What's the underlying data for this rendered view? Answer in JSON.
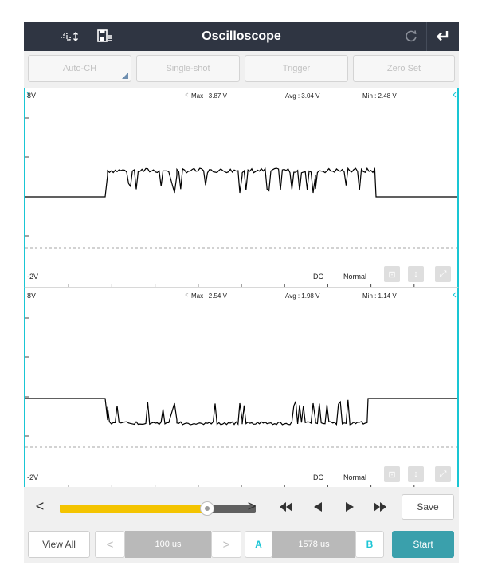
{
  "header": {
    "title": "Oscilloscope",
    "left_icons": [
      "waveform-icon",
      "save-list-icon"
    ],
    "right_icons": [
      "refresh-icon",
      "back-arrow-icon"
    ]
  },
  "toolbar": {
    "auto_ch": "Auto-CH",
    "single_shot": "Single-shot",
    "trigger": "Trigger",
    "zero_set": "Zero Set"
  },
  "channel1": {
    "top_label": "8V",
    "bottom_label": "-2V",
    "max": "Max : 3.87 V",
    "avg": "Avg : 3.04 V",
    "min": "Min : 2.48 V",
    "coupling": "DC",
    "mode": "Normal"
  },
  "channel2": {
    "top_label": "8V",
    "bottom_label": "-2V",
    "max": "Max : 2.54 V",
    "avg": "Avg : 1.98 V",
    "min": "Min : 1.14 V",
    "coupling": "DC",
    "mode": "Normal"
  },
  "controls": {
    "prev": "<",
    "next": ">",
    "slider_position": 0.75,
    "save": "Save"
  },
  "bottom": {
    "view_all": "View All",
    "prev": "<",
    "next": ">",
    "timebase": "100 us",
    "cursor_a": "A",
    "cursor_delta": "1578 us",
    "cursor_b": "B",
    "start": "Start"
  },
  "colors": {
    "header_bg": "#2f3542",
    "cursor_line": "#19c6d4",
    "slider_fill": "#f4c400",
    "start_button": "#3aa0ac",
    "cursor_text": "#1fc6d6",
    "field_bg": "#b9b9b9"
  }
}
